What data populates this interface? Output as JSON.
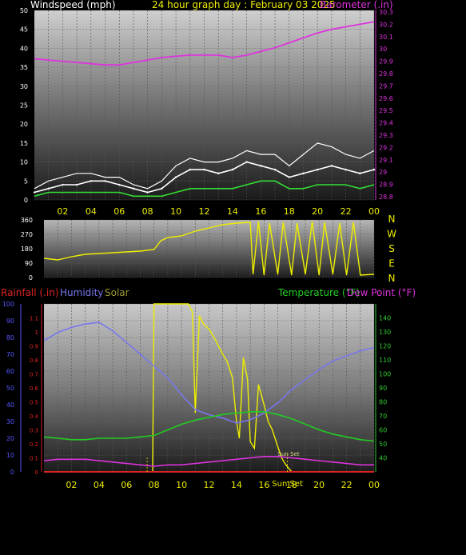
{
  "header": {
    "windspeed_label": "Windspeed (mph)",
    "title": "24 hour graph day : February 03 2025",
    "barometer_label": "Barometer (.in)"
  },
  "bottom_header": {
    "rainfall_label": "Rainfall (.in)",
    "humidity_label": "Humidity",
    "solar_label": "Solar",
    "temperature_label": "Temperature (°F)",
    "dewpoint_label": "Dew Point (°F)"
  },
  "colors": {
    "windspeed": "#ffffff",
    "windgust": "#ffffff",
    "windavg": "#33dd33",
    "barometer": "#dd33dd",
    "direction": "#eeee00",
    "rain": "#dd2222",
    "humidity": "#7777ee",
    "solar": "#eeee00",
    "temperature": "#22cc22",
    "dewpoint": "#dd33dd",
    "axis_left": "#5555ff",
    "axis_barometer": "#dd33dd",
    "axis_temperature": "#33cc33",
    "axis_time": "#eeee00",
    "axis_rain": "#dd2222"
  },
  "hour_labels": [
    "02",
    "04",
    "06",
    "08",
    "10",
    "12",
    "14",
    "16",
    "18",
    "20",
    "22",
    "00"
  ],
  "direction_letters": [
    "N",
    "W",
    "S",
    "E",
    "N"
  ],
  "annotations": {
    "sunset": "Sun Set",
    "sunset_bottom": "Sun Set",
    "sunset_time": "18"
  },
  "chart_data": [
    {
      "type": "line",
      "x_unit": "hour",
      "xlim": [
        0,
        24
      ],
      "ylim_left": [
        0,
        50
      ],
      "left_ticks": [
        0,
        5,
        10,
        15,
        20,
        25,
        30,
        35,
        40,
        45,
        50
      ],
      "ylim_right": [
        29.8,
        30.3
      ],
      "right_ticks": [
        "29.8",
        "29.9",
        "29.9",
        "29.9",
        "29.9",
        "29.9",
        "29.9",
        "29.9",
        "29.7",
        "29.6",
        "29.5",
        "29.5",
        "29.4",
        "29.3",
        "29.2",
        "29.1",
        "29",
        "28.9",
        "28.8",
        "30.3"
      ],
      "right_tick_labels": [
        "30.3",
        "30.2",
        "30.1",
        "30",
        "29.9",
        "29.8",
        "29.7",
        "29.6",
        "29.5",
        "29.4",
        "29.3",
        "29.2",
        "29.1",
        "29",
        "28.9",
        "28.8"
      ],
      "series": [
        {
          "name": "Windspeed (mph)",
          "axis": "left",
          "x": [
            0,
            1,
            2,
            3,
            4,
            5,
            6,
            7,
            8,
            9,
            10,
            11,
            12,
            13,
            14,
            15,
            16,
            17,
            18,
            19,
            20,
            21,
            22,
            23,
            24
          ],
          "values": [
            2,
            3,
            4,
            4,
            5,
            5,
            4,
            3,
            2,
            3,
            6,
            8,
            8,
            7,
            8,
            10,
            9,
            8,
            6,
            7,
            8,
            9,
            8,
            7,
            8
          ]
        },
        {
          "name": "Wind Gust (mph)",
          "axis": "left",
          "x": [
            0,
            1,
            2,
            3,
            4,
            5,
            6,
            7,
            8,
            9,
            10,
            11,
            12,
            13,
            14,
            15,
            16,
            17,
            18,
            19,
            20,
            21,
            22,
            23,
            24
          ],
          "values": [
            3,
            5,
            6,
            7,
            7,
            6,
            6,
            4,
            3,
            5,
            9,
            11,
            10,
            10,
            11,
            13,
            12,
            12,
            9,
            12,
            15,
            14,
            12,
            11,
            13
          ]
        },
        {
          "name": "Average Wind (mph)",
          "axis": "left",
          "x": [
            0,
            1,
            2,
            3,
            4,
            5,
            6,
            7,
            8,
            9,
            10,
            11,
            12,
            13,
            14,
            15,
            16,
            17,
            18,
            19,
            20,
            21,
            22,
            23,
            24
          ],
          "values": [
            1,
            2,
            2,
            2,
            2,
            2,
            2,
            1,
            1,
            1,
            2,
            3,
            3,
            3,
            3,
            4,
            5,
            5,
            3,
            3,
            4,
            4,
            4,
            3,
            4
          ]
        },
        {
          "name": "Barometer (.in)",
          "axis": "right",
          "x": [
            0,
            1,
            2,
            3,
            4,
            5,
            6,
            7,
            8,
            9,
            10,
            11,
            12,
            13,
            14,
            15,
            16,
            17,
            18,
            19,
            20,
            21,
            22,
            23,
            24
          ],
          "values": [
            29.92,
            29.91,
            29.9,
            29.89,
            29.88,
            29.87,
            29.87,
            29.89,
            29.91,
            29.93,
            29.94,
            29.95,
            29.95,
            29.95,
            29.93,
            29.95,
            29.98,
            30.01,
            30.05,
            30.09,
            30.13,
            30.16,
            30.18,
            30.2,
            30.22
          ]
        }
      ]
    },
    {
      "type": "line",
      "x_unit": "hour",
      "xlim": [
        0,
        24
      ],
      "ylim": [
        0,
        360
      ],
      "ticks": [
        0,
        90,
        180,
        270,
        360
      ],
      "series": [
        {
          "name": "Wind Direction (deg)",
          "x": [
            0,
            1,
            2,
            3,
            4,
            5,
            6,
            7,
            8,
            8.5,
            9,
            10,
            11,
            12,
            13,
            14,
            15,
            15.2,
            15.6,
            16,
            16.4,
            17,
            17.4,
            18,
            18.4,
            19,
            19.5,
            20,
            20.4,
            21,
            21.5,
            22,
            22.5,
            23,
            24
          ],
          "values": [
            120,
            110,
            130,
            145,
            150,
            155,
            160,
            165,
            175,
            230,
            250,
            260,
            290,
            310,
            330,
            340,
            345,
            20,
            350,
            15,
            340,
            20,
            345,
            15,
            340,
            20,
            350,
            15,
            345,
            20,
            340,
            15,
            345,
            15,
            20
          ]
        }
      ]
    },
    {
      "type": "line",
      "x_unit": "hour",
      "xlim": [
        0,
        24
      ],
      "ylim_humidity": [
        0,
        100
      ],
      "humidity_ticks": [
        0,
        10,
        20,
        30,
        40,
        50,
        60,
        70,
        80,
        90,
        100
      ],
      "ylim_rain": [
        0,
        1.2
      ],
      "rain_ticks": [
        "0",
        "0.1",
        "0.2",
        "0.3",
        "0.4",
        "0.5",
        "0.6",
        "0.7",
        "0.8",
        "0.9",
        "1",
        "1.1"
      ],
      "ylim_temperature": [
        30,
        150
      ],
      "temperature_ticks": [
        40,
        50,
        60,
        70,
        80,
        90,
        100,
        110,
        120,
        130,
        140
      ],
      "series": [
        {
          "name": "Humidity",
          "axis": "humidity",
          "x": [
            0,
            1,
            2,
            3,
            4,
            5,
            6,
            7,
            8,
            9,
            10,
            11,
            12,
            13,
            14,
            15,
            16,
            17,
            18,
            19,
            20,
            21,
            22,
            23,
            24
          ],
          "values": [
            78,
            83,
            86,
            88,
            89,
            84,
            77,
            70,
            63,
            56,
            46,
            37,
            34,
            32,
            29,
            31,
            35,
            41,
            49,
            55,
            61,
            66,
            69,
            72,
            74
          ]
        },
        {
          "name": "Temperature (°F)",
          "axis": "temperature",
          "x": [
            0,
            1,
            2,
            3,
            4,
            5,
            6,
            7,
            8,
            9,
            10,
            11,
            12,
            13,
            14,
            15,
            16,
            17,
            18,
            19,
            20,
            21,
            22,
            23,
            24
          ],
          "values": [
            55,
            54,
            53,
            53,
            54,
            54,
            54,
            55,
            56,
            60,
            64,
            67,
            69,
            71,
            72,
            73,
            73,
            71,
            68,
            64,
            60,
            57,
            55,
            53,
            52
          ]
        },
        {
          "name": "Dew Point (°F)",
          "axis": "temperature",
          "x": [
            0,
            1,
            2,
            3,
            4,
            5,
            6,
            7,
            8,
            9,
            10,
            11,
            12,
            13,
            14,
            15,
            16,
            17,
            18,
            19,
            20,
            21,
            22,
            23,
            24
          ],
          "values": [
            38,
            39,
            39,
            39,
            38,
            37,
            36,
            35,
            34,
            35,
            35,
            36,
            37,
            38,
            39,
            40,
            41,
            41,
            40,
            39,
            38,
            37,
            36,
            35,
            35
          ]
        },
        {
          "name": "Rainfall (.in)",
          "axis": "rain",
          "x": [
            0,
            24
          ],
          "values": [
            0,
            0
          ]
        },
        {
          "name": "Solar",
          "axis": "humidity",
          "x": [
            0,
            7.9,
            8.0,
            9,
            10,
            10.5,
            10.8,
            11,
            11.3,
            11.6,
            12,
            12.5,
            13,
            13.3,
            13.7,
            14,
            14.2,
            14.5,
            14.8,
            15,
            15.3,
            15.6,
            16,
            16.3,
            16.6,
            17,
            17.3,
            17.6,
            18,
            24
          ],
          "values": [
            0,
            0,
            100,
            100,
            100,
            100,
            95,
            35,
            93,
            88,
            85,
            78,
            70,
            66,
            56,
            30,
            20,
            68,
            55,
            18,
            14,
            52,
            40,
            30,
            25,
            15,
            8,
            4,
            0,
            0
          ]
        }
      ]
    }
  ]
}
